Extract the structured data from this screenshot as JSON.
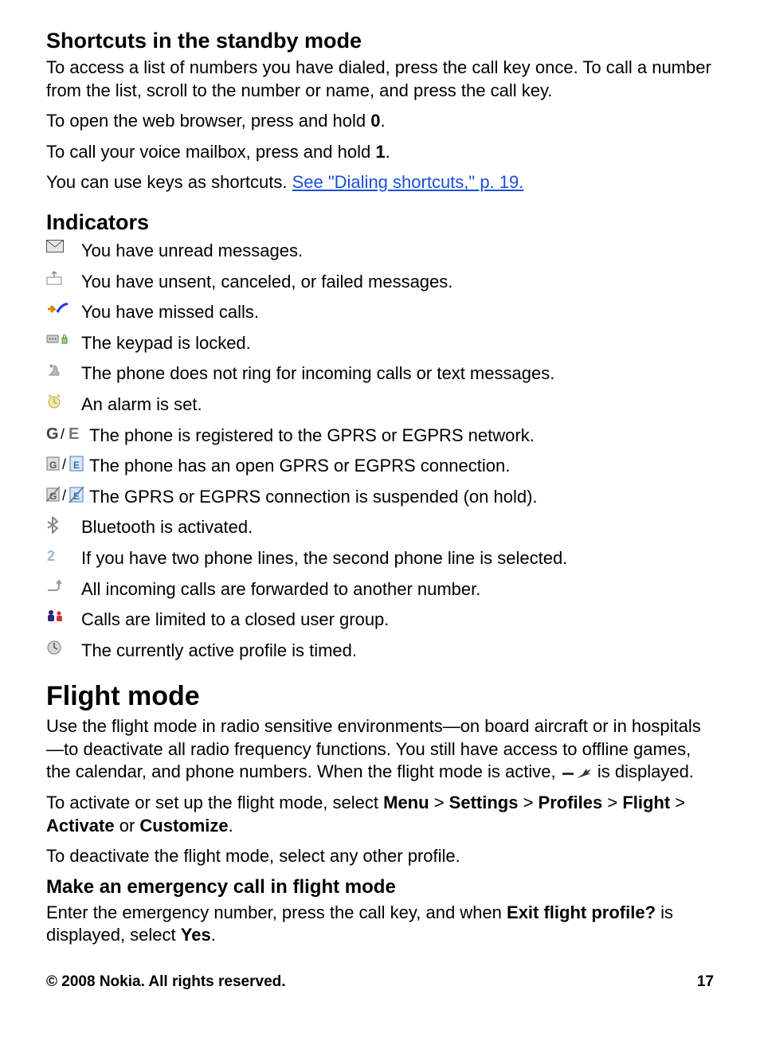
{
  "section1": {
    "heading": "Shortcuts in the standby mode",
    "p1": "To access a list of numbers you have dialed, press the call key once. To call a number from the list, scroll to the number or name, and press the call key.",
    "p2_pre": "To open the web browser, press and hold ",
    "p2_bold": "0",
    "p2_post": ".",
    "p3_pre": "To call your voice mailbox, press and hold ",
    "p3_bold": "1",
    "p3_post": ".",
    "p4_pre": "You can use keys as shortcuts. ",
    "p4_link": "See \"Dialing shortcuts,\" p. 19."
  },
  "section2": {
    "heading": "Indicators",
    "items": [
      {
        "icon": "envelope-icon",
        "text": " You have unread messages."
      },
      {
        "icon": "outbox-icon",
        "text": " You have unsent, canceled, or failed messages."
      },
      {
        "icon": "missed-call-icon",
        "text": " You have missed calls."
      },
      {
        "icon": "keypad-lock-icon",
        "text": " The keypad is locked."
      },
      {
        "icon": "silent-icon",
        "text": " The phone does not ring for incoming calls or text messages."
      },
      {
        "icon": "alarm-icon",
        "text": " An alarm is set."
      },
      {
        "icon": "gprs-g-e-icon",
        "text": " The phone is registered to the GPRS or EGPRS network."
      },
      {
        "icon": "gprs-open-icon",
        "text": " The phone has an open GPRS or EGPRS connection."
      },
      {
        "icon": "gprs-suspended-icon",
        "text": " The GPRS or EGPRS connection is suspended (on hold)."
      },
      {
        "icon": "bluetooth-icon",
        "text": " Bluetooth is activated."
      },
      {
        "icon": "line2-icon",
        "text": " If you have two phone lines, the second phone line is selected."
      },
      {
        "icon": "forward-icon",
        "text": " All incoming calls are forwarded to another number."
      },
      {
        "icon": "closed-group-icon",
        "text": " Calls are limited to a closed user group."
      },
      {
        "icon": "timed-profile-icon",
        "text": " The currently active profile is timed."
      }
    ]
  },
  "section3": {
    "heading": "Flight mode",
    "p1_pre": "Use the flight mode in radio sensitive environments—on board aircraft or in hospitals—to deactivate all radio frequency functions. You still have access to offline games, the calendar, and phone numbers. When the flight mode is active, ",
    "p1_post": " is displayed.",
    "p2": {
      "s0": "To activate or set up the flight mode, select ",
      "b1": "Menu",
      "gt1": " > ",
      "b2": "Settings",
      "gt2": " > ",
      "b3": "Profiles",
      "gt3": " > ",
      "b4": "Flight",
      "gt4": " > ",
      "b5": "Activate",
      "or": " or ",
      "b6": "Customize",
      "end": "."
    },
    "p3": "To deactivate the flight mode, select any other profile.",
    "sub": "Make an emergency call in flight mode",
    "p4": {
      "s0": "Enter the emergency number, press the call key, and when ",
      "b1": "Exit flight profile?",
      "s1": " is displayed, select ",
      "b2": "Yes",
      "end": "."
    }
  },
  "footer": {
    "left": "© 2008 Nokia. All rights reserved.",
    "right": "17"
  }
}
